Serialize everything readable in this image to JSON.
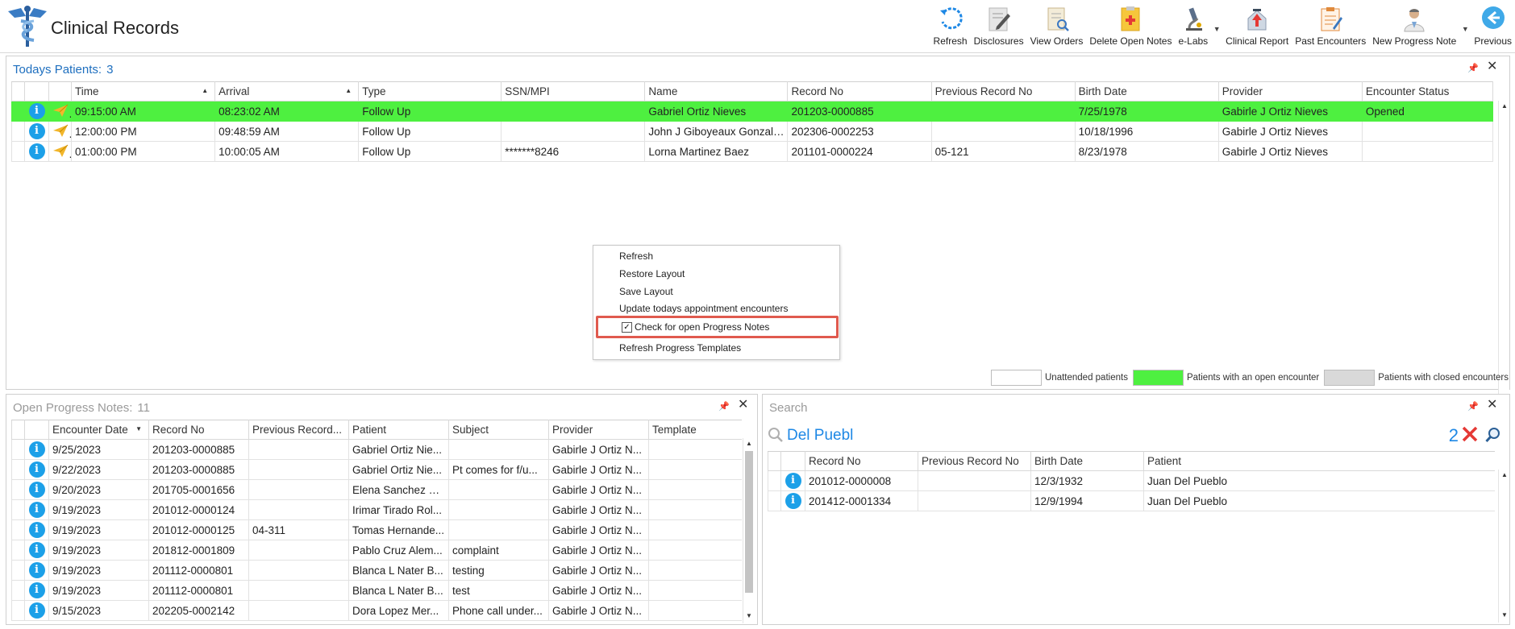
{
  "app": {
    "title": "Clinical Records"
  },
  "toolbar": [
    {
      "id": "refresh",
      "label": "Refresh",
      "icon": "refresh-icon"
    },
    {
      "id": "disclosures",
      "label": "Disclosures",
      "icon": "document-edit-icon"
    },
    {
      "id": "view-orders",
      "label": "View Orders",
      "icon": "document-search-icon"
    },
    {
      "id": "delete-open-notes",
      "label": "Delete Open Notes",
      "icon": "note-delete-icon"
    },
    {
      "id": "e-labs",
      "label": "e-Labs",
      "icon": "microscope-icon",
      "dropdown": true
    },
    {
      "id": "clinical-report",
      "label": "Clinical Report",
      "icon": "house-arrow-icon"
    },
    {
      "id": "past-encounters",
      "label": "Past Encounters",
      "icon": "clipboard-icon"
    },
    {
      "id": "new-progress-note",
      "label": "New Progress Note",
      "icon": "doctor-icon",
      "dropdown": true
    },
    {
      "id": "previous",
      "label": "Previous",
      "icon": "back-arrow-icon"
    }
  ],
  "todays_patients": {
    "title": "Todays Patients:",
    "count": "3",
    "columns": [
      "Time",
      "Arrival",
      "Type",
      "SSN/MPI",
      "Name",
      "Record No",
      "Previous Record No",
      "Birth Date",
      "Provider",
      "Encounter Status"
    ],
    "rows": [
      {
        "time": "09:15:00 AM",
        "arrival": "08:23:02 AM",
        "type": "Follow Up",
        "ssn": "",
        "name": "Gabriel Ortiz Nieves",
        "record": "201203-0000885",
        "prev_record": "",
        "birth": "7/25/1978",
        "provider": "Gabirle J Ortiz Nieves",
        "status": "Opened",
        "open": true
      },
      {
        "time": "12:00:00 PM",
        "arrival": "09:48:59 AM",
        "type": "Follow Up",
        "ssn": "",
        "name": "John J Giboyeaux Gonzalez",
        "record": "202306-0002253",
        "prev_record": "",
        "birth": "10/18/1996",
        "provider": "Gabirle J Ortiz Nieves",
        "status": "",
        "open": false
      },
      {
        "time": "01:00:00 PM",
        "arrival": "10:00:05 AM",
        "type": "Follow Up",
        "ssn": "*******8246",
        "name": "Lorna Martinez Baez",
        "record": "201101-0000224",
        "prev_record": "05-121",
        "birth": "8/23/1978",
        "provider": "Gabirle J Ortiz Nieves",
        "status": "",
        "open": false
      }
    ]
  },
  "legend": {
    "unattended": "Unattended patients",
    "open": "Patients with an open encounter",
    "closed": "Patients with closed encounters",
    "colors": {
      "unattended": "#ffffff",
      "open": "#4ef040",
      "closed": "#d9d9d9"
    }
  },
  "context_menu": {
    "items": [
      "Refresh",
      "Restore Layout",
      "Save Layout",
      "Update todays appointment encounters",
      "Check for open Progress Notes",
      "Refresh Progress Templates"
    ],
    "checked": "Check for open Progress Notes"
  },
  "open_notes": {
    "title": "Open Progress Notes:",
    "count": "11",
    "columns": [
      "Encounter Date",
      "Record No",
      "Previous Record...",
      "Patient",
      "Subject",
      "Provider",
      "Template"
    ],
    "rows": [
      {
        "date": "9/25/2023",
        "record": "201203-0000885",
        "prev": "",
        "patient": "Gabriel Ortiz Nie...",
        "subject": "",
        "provider": "Gabirle J Ortiz N...",
        "template": ""
      },
      {
        "date": "9/22/2023",
        "record": "201203-0000885",
        "prev": "",
        "patient": "Gabriel Ortiz Nie...",
        "subject": "Pt comes for f/u...",
        "provider": "Gabirle J Ortiz N...",
        "template": ""
      },
      {
        "date": "9/20/2023",
        "record": "201705-0001656",
        "prev": "",
        "patient": "Elena Sanchez Ri...",
        "subject": "",
        "provider": "Gabirle J Ortiz N...",
        "template": ""
      },
      {
        "date": "9/19/2023",
        "record": "201012-0000124",
        "prev": "",
        "patient": "Irimar Tirado Rol...",
        "subject": "",
        "provider": "Gabirle J Ortiz N...",
        "template": ""
      },
      {
        "date": "9/19/2023",
        "record": "201012-0000125",
        "prev": "04-311",
        "patient": "Tomas Hernande...",
        "subject": "",
        "provider": "Gabirle J Ortiz N...",
        "template": ""
      },
      {
        "date": "9/19/2023",
        "record": "201812-0001809",
        "prev": "",
        "patient": "Pablo Cruz Alem...",
        "subject": "complaint",
        "provider": "Gabirle J Ortiz N...",
        "template": ""
      },
      {
        "date": "9/19/2023",
        "record": "201112-0000801",
        "prev": "",
        "patient": "Blanca L Nater B...",
        "subject": "testing",
        "provider": "Gabirle J Ortiz N...",
        "template": ""
      },
      {
        "date": "9/19/2023",
        "record": "201112-0000801",
        "prev": "",
        "patient": "Blanca L Nater B...",
        "subject": "test",
        "provider": "Gabirle J Ortiz N...",
        "template": ""
      },
      {
        "date": "9/15/2023",
        "record": "202205-0002142",
        "prev": "",
        "patient": "Dora Lopez Mer...",
        "subject": "Phone call under...",
        "provider": "Gabirle J Ortiz N...",
        "template": ""
      }
    ]
  },
  "search": {
    "title": "Search",
    "query": "Del Puebl",
    "result_count": "2",
    "columns": [
      "Record No",
      "Previous Record No",
      "Birth Date",
      "Patient"
    ],
    "rows": [
      {
        "record": "201012-0000008",
        "prev": "",
        "birth": "12/3/1932",
        "patient": "Juan Del Pueblo"
      },
      {
        "record": "201412-0001334",
        "prev": "",
        "birth": "12/9/1994",
        "patient": "Juan Del Pueblo"
      }
    ]
  }
}
